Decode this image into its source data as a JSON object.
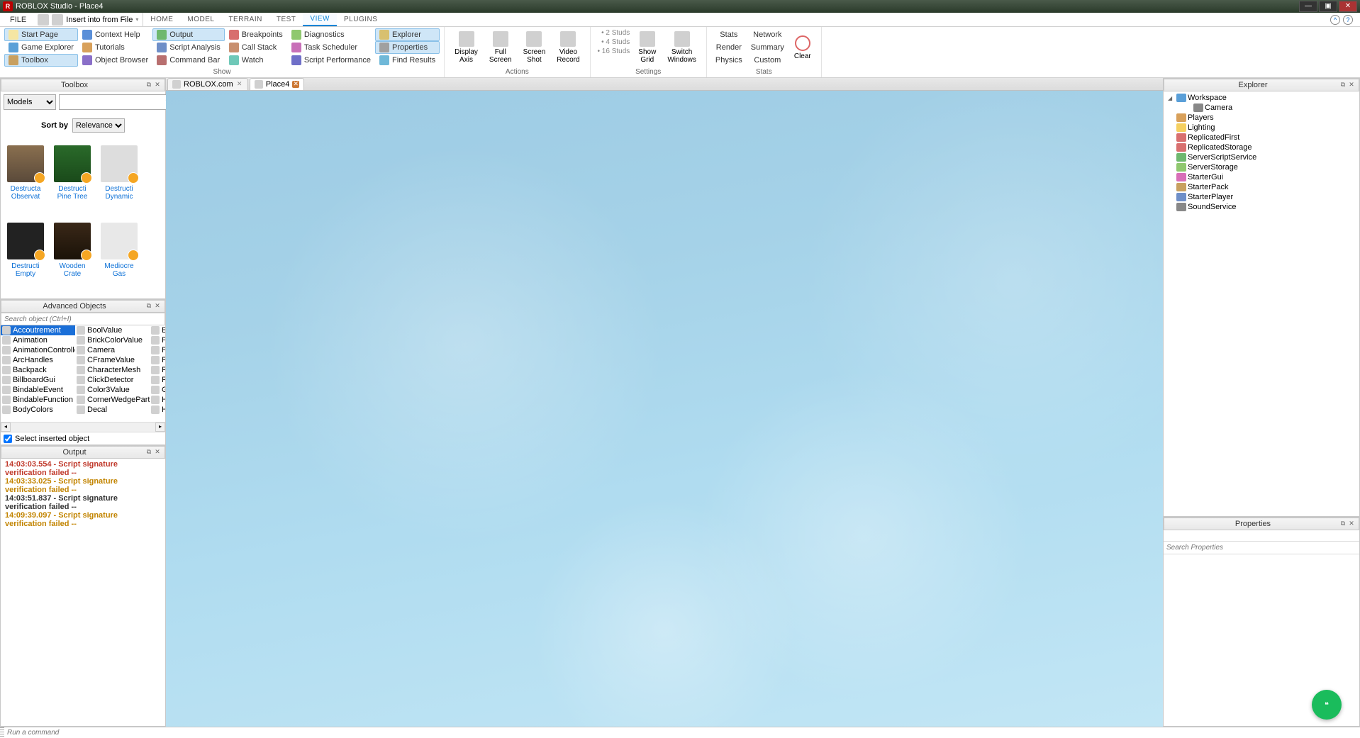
{
  "titlebar": {
    "app": "ROBLOX Studio",
    "doc": "Place4",
    "title": "ROBLOX Studio - Place4"
  },
  "menubar": {
    "file": "FILE",
    "qat_insert": "Insert into from File",
    "tabs": [
      "HOME",
      "MODEL",
      "TERRAIN",
      "TEST",
      "VIEW",
      "PLUGINS"
    ],
    "active_tab": 4
  },
  "ribbon": {
    "show": {
      "label": "Show",
      "col1": [
        "Start Page",
        "Game Explorer",
        "Toolbox"
      ],
      "col2": [
        "Context Help",
        "Tutorials",
        "Object Browser"
      ],
      "col3": [
        "Output",
        "Script Analysis",
        "Command Bar"
      ],
      "col4": [
        "Breakpoints",
        "Call Stack",
        "Watch"
      ],
      "col5": [
        "Diagnostics",
        "Task Scheduler",
        "Script Performance"
      ],
      "col6": [
        "Explorer",
        "Properties",
        "Find Results"
      ],
      "selected": [
        "Start Page",
        "Toolbox",
        "Output",
        "Explorer",
        "Properties"
      ]
    },
    "actions": {
      "label": "Actions",
      "buttons": [
        {
          "l1": "Display",
          "l2": "Axis"
        },
        {
          "l1": "Full",
          "l2": "Screen"
        },
        {
          "l1": "Screen",
          "l2": "Shot"
        },
        {
          "l1": "Video",
          "l2": "Record"
        }
      ]
    },
    "settings": {
      "label": "Settings",
      "studs": [
        "2 Studs",
        "4 Studs",
        "16 Studs"
      ],
      "buttons": [
        {
          "l1": "Show",
          "l2": "Grid"
        },
        {
          "l1": "Switch",
          "l2": "Windows"
        }
      ]
    },
    "stats": {
      "label": "Stats",
      "row1": [
        "Stats",
        "Network"
      ],
      "row2": [
        "Render",
        "Summary"
      ],
      "row3": [
        "Physics",
        "Custom"
      ],
      "clear": "Clear"
    }
  },
  "toolbox": {
    "title": "Toolbox",
    "category": "Models",
    "sort_label": "Sort by",
    "sort_value": "Relevance",
    "items": [
      {
        "label": "Destructa Observat"
      },
      {
        "label": "Destructi Pine Tree"
      },
      {
        "label": "Destructi Dynamic"
      },
      {
        "label": "Destructi Empty"
      },
      {
        "label": "Wooden Crate"
      },
      {
        "label": "Mediocre Gas"
      }
    ]
  },
  "advobj": {
    "title": "Advanced Objects",
    "search_placeholder": "Search object (Ctrl+I)",
    "col1": [
      "Accoutrement",
      "Animation",
      "AnimationController",
      "ArcHandles",
      "Backpack",
      "BillboardGui",
      "BindableEvent",
      "BindableFunction",
      "BodyColors"
    ],
    "col2": [
      "BoolValue",
      "BrickColorValue",
      "Camera",
      "CFrameValue",
      "CharacterMesh",
      "ClickDetector",
      "Color3Value",
      "CornerWedgePart",
      "Decal"
    ],
    "col3": [
      "Exp",
      "Flag",
      "Flag",
      "Flo",
      "For",
      "Fra",
      "Glu",
      "Har",
      "Hat"
    ],
    "selected": "Accoutrement",
    "footer_checkbox": "Select inserted object"
  },
  "output": {
    "title": "Output",
    "lines": [
      {
        "cls": "err",
        "text": "14:03:03.554 - Script signature verification failed --"
      },
      {
        "cls": "warn",
        "text": "14:03:33.025 - Script signature verification failed --"
      },
      {
        "cls": "norm",
        "text": "14:03:51.837 - Script signature verification failed --"
      },
      {
        "cls": "warn",
        "text": "14:09:39.097 - Script signature verification failed --"
      }
    ]
  },
  "doctabs": [
    {
      "label": "ROBLOX.com",
      "active": false,
      "closeStyle": "gray"
    },
    {
      "label": "Place4",
      "active": true,
      "closeStyle": "red"
    }
  ],
  "explorer": {
    "title": "Explorer",
    "nodes": [
      {
        "name": "Workspace",
        "icon": "ws",
        "expandable": true,
        "expanded": true,
        "level": 0
      },
      {
        "name": "Camera",
        "icon": "cam",
        "level": 1
      },
      {
        "name": "Players",
        "icon": "pl",
        "level": 0
      },
      {
        "name": "Lighting",
        "icon": "lt",
        "level": 0
      },
      {
        "name": "ReplicatedFirst",
        "icon": "rf",
        "level": 0
      },
      {
        "name": "ReplicatedStorage",
        "icon": "rs",
        "level": 0
      },
      {
        "name": "ServerScriptService",
        "icon": "ss",
        "level": 0
      },
      {
        "name": "ServerStorage",
        "icon": "st",
        "level": 0
      },
      {
        "name": "StarterGui",
        "icon": "sg",
        "level": 0
      },
      {
        "name": "StarterPack",
        "icon": "sp",
        "level": 0
      },
      {
        "name": "StarterPlayer",
        "icon": "spl",
        "level": 0
      },
      {
        "name": "SoundService",
        "icon": "snd",
        "level": 0
      }
    ]
  },
  "properties": {
    "title": "Properties",
    "search_placeholder": "Search Properties"
  },
  "cmdbar": {
    "placeholder": "Run a command"
  }
}
